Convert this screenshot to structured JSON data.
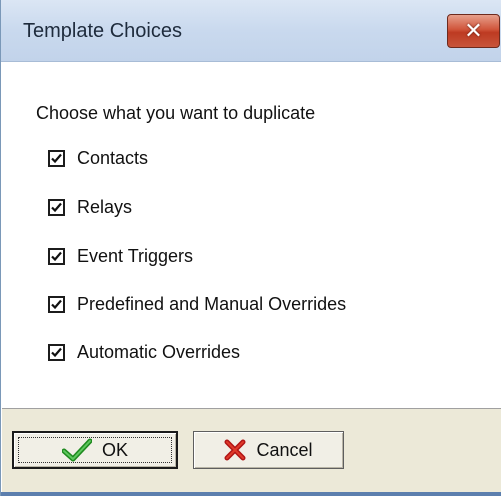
{
  "window": {
    "title": "Template Choices",
    "close_icon": "close-icon",
    "accent_color": "#c8553a"
  },
  "main": {
    "prompt": "Choose what you want to duplicate",
    "options": [
      {
        "label": "Contacts",
        "checked": true
      },
      {
        "label": "Relays",
        "checked": true
      },
      {
        "label": "Event Triggers",
        "checked": true
      },
      {
        "label": "Predefined and Manual Overrides",
        "checked": true
      },
      {
        "label": "Automatic Overrides",
        "checked": true
      }
    ]
  },
  "footer": {
    "ok_label": "OK",
    "ok_icon": "checkmark-icon",
    "cancel_label": "Cancel",
    "cancel_icon": "red-x-icon"
  }
}
